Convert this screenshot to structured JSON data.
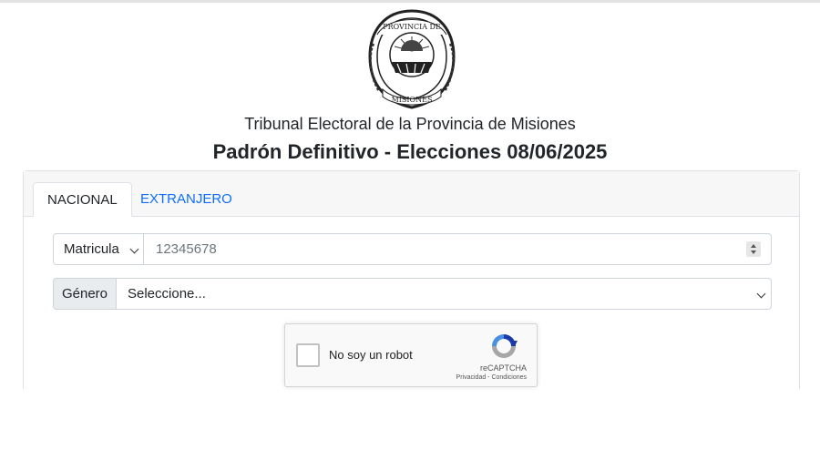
{
  "org": {
    "name": "Tribunal Electoral de la Provincia de Misiones",
    "seal_top_text": "PROVINCIA DE",
    "seal_bottom_text": "MISIONES"
  },
  "page": {
    "title": "Padrón Definitivo - Elecciones 08/06/2025"
  },
  "tabs": [
    {
      "label": "NACIONAL",
      "active": true
    },
    {
      "label": "EXTRANJERO",
      "active": false
    }
  ],
  "form": {
    "document_type": {
      "selected": "Matricula"
    },
    "document_number": {
      "value": "12345678"
    },
    "gender": {
      "label": "Género",
      "selected": "Seleccione..."
    }
  },
  "captcha": {
    "checkbox_label": "No soy un robot",
    "brand": "reCAPTCHA",
    "privacy_label": "Privacidad",
    "separator": " - ",
    "terms_label": "Condiciones"
  },
  "colors": {
    "link": "#0d6efd",
    "border": "#dee2e6",
    "input_group_bg": "#e9ecef",
    "captcha_blue": "#1c3aa9",
    "captcha_light_blue": "#4a90e2",
    "captcha_gray": "#a6a6a6"
  }
}
